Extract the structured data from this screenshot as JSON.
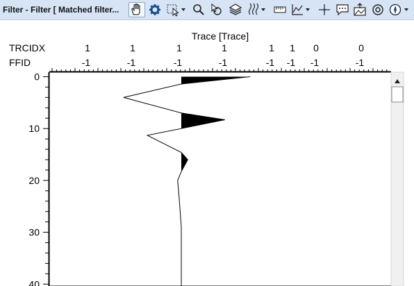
{
  "window": {
    "title": "Filter - Filter [ Matched filter..."
  },
  "toolbar": {
    "icons": [
      {
        "name": "pan-hand-icon",
        "active": true
      },
      {
        "name": "gear-icon"
      },
      {
        "name": "selection-rect-icon",
        "dropdown": true
      },
      {
        "name": "zoom-magnifier-icon"
      },
      {
        "name": "pick-pointer-icon"
      },
      {
        "name": "layers-icon"
      },
      {
        "name": "wiggle-display-icon",
        "dropdown": true
      },
      {
        "name": "scale-ruler-icon"
      },
      {
        "name": "graph-line-icon",
        "dropdown": true
      },
      {
        "name": "crosshair-icon"
      },
      {
        "name": "annotation-comment-icon"
      },
      {
        "name": "export-image-icon"
      },
      {
        "name": "zoom-extent-icon"
      },
      {
        "name": "compass-icon",
        "dropdown": true
      }
    ]
  },
  "chart_data": {
    "type": "line",
    "title": "Trace [Trace]",
    "header_rows": [
      {
        "label": "TRCIDX",
        "values": [
          "1",
          "1",
          "1",
          "1",
          "1",
          "1",
          "0",
          "0"
        ]
      },
      {
        "label": "FFID",
        "values": [
          "-1",
          "-1",
          "-1",
          "-1",
          "-1",
          "-1",
          "-1",
          "-1"
        ]
      }
    ],
    "y_ticks": [
      "0",
      "10",
      "20",
      "30",
      "40"
    ],
    "y_values": [
      0,
      10,
      20,
      30,
      40
    ],
    "ylim": [
      -0.2,
      40.8
    ],
    "xlim": [
      -1.46,
      2.2
    ],
    "series": [
      {
        "values": [
          {
            "y": 0,
            "x": 1.5
          },
          {
            "y": 1.4,
            "x": 0.0
          },
          {
            "y": 4.0,
            "x": -1.26
          },
          {
            "y": 7.0,
            "x": 0.0
          },
          {
            "y": 8.3,
            "x": 0.95
          },
          {
            "y": 10.0,
            "x": 0.0
          },
          {
            "y": 11.3,
            "x": -0.74
          },
          {
            "y": 14.6,
            "x": 0.0
          },
          {
            "y": 16.0,
            "x": 0.14
          },
          {
            "y": 18.3,
            "x": 0.0
          },
          {
            "y": 20.0,
            "x": -0.08
          },
          {
            "y": 23.0,
            "x": -0.05
          },
          {
            "y": 29.0,
            "x": 0.0
          },
          {
            "y": 40.8,
            "x": 0.0
          }
        ]
      }
    ],
    "grid": false,
    "fill_positive": true
  }
}
